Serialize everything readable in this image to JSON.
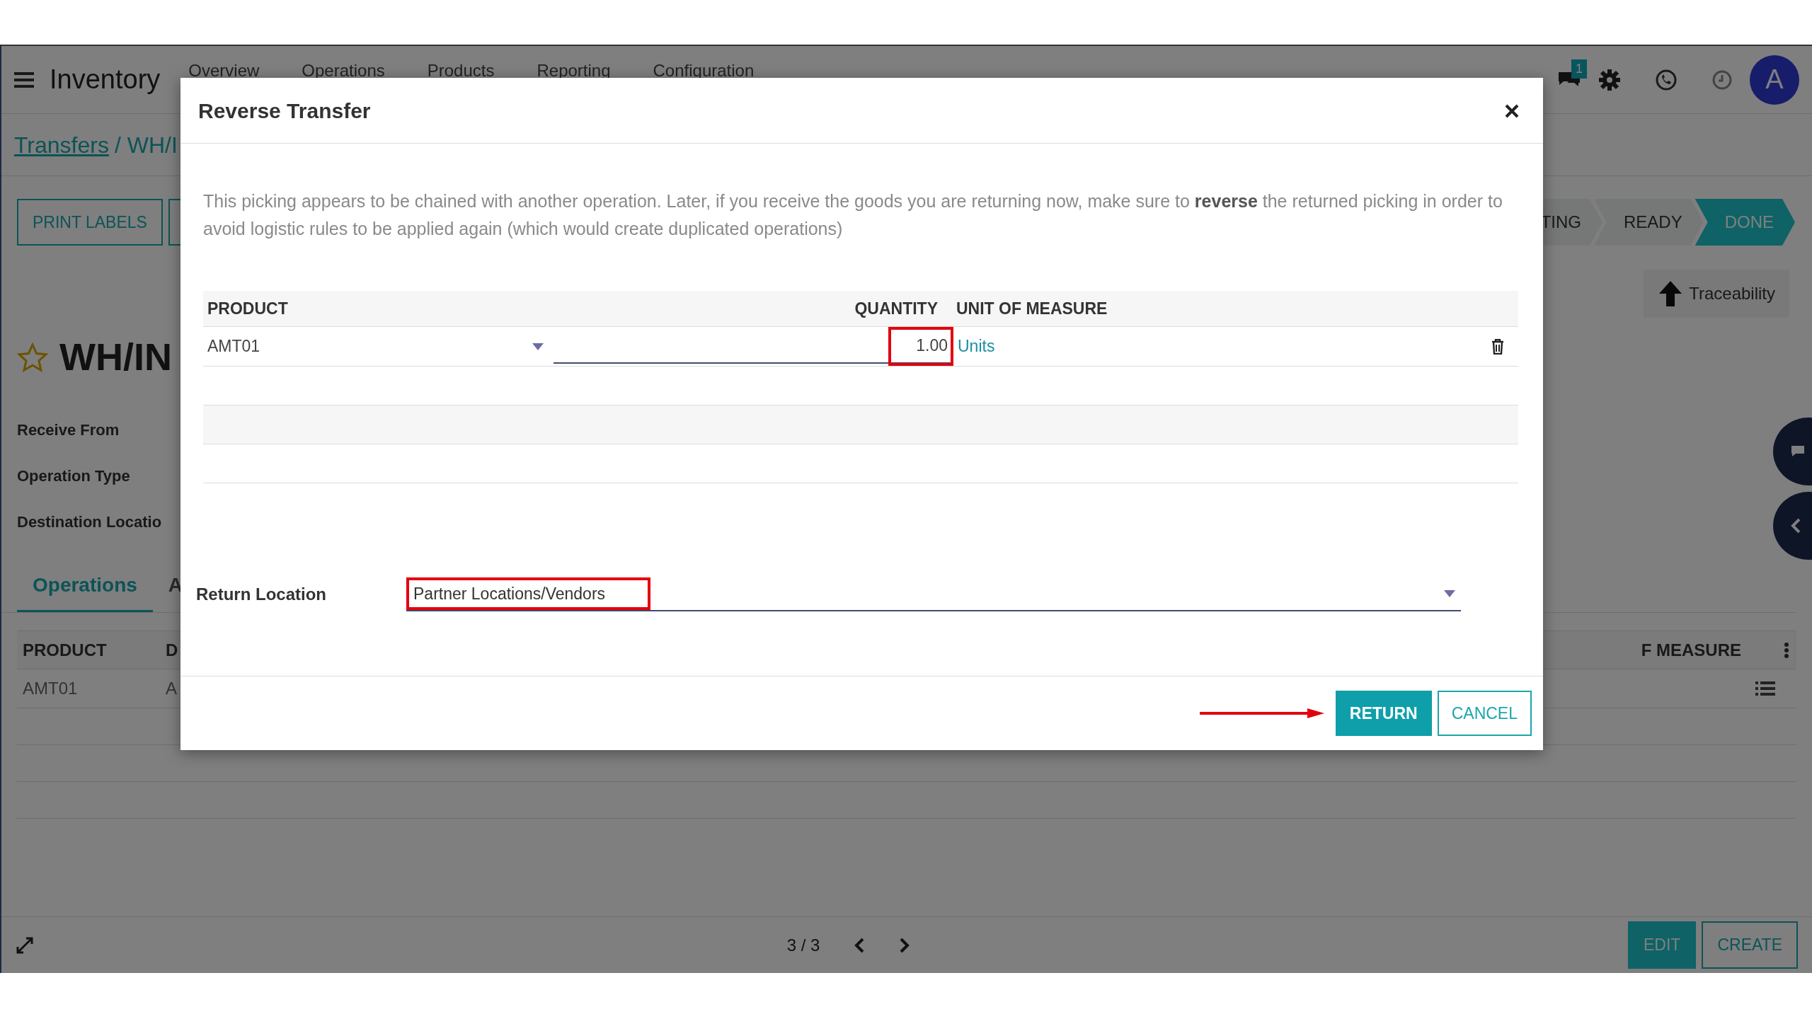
{
  "app_bar": {
    "app_name": "Inventory",
    "menu": [
      "Overview",
      "Operations",
      "Products",
      "Reporting",
      "Configuration"
    ],
    "message_count": "1",
    "avatar_letter": "A"
  },
  "breadcrumb": [
    {
      "label": "Transfers"
    },
    {
      "label": "/ WH/I"
    }
  ],
  "actions": [
    "PRINT LABELS"
  ],
  "status_steps": [
    {
      "label": "TING",
      "selected": false
    },
    {
      "label": "READY",
      "selected": false
    },
    {
      "label": "DONE",
      "selected": true
    }
  ],
  "smart_buttons": [
    "Traceability"
  ],
  "record": {
    "starred": false,
    "title": "WH/IN"
  },
  "fields": [
    "Receive From",
    "Operation Type",
    "Destination Locatio"
  ],
  "tabs": [
    {
      "label": "Operations",
      "selected": true
    },
    {
      "label": "A",
      "selected": false
    }
  ],
  "operations_table": {
    "columns": [
      "PRODUCT",
      "D",
      "F MEASURE"
    ],
    "rows": [
      [
        "AMT01",
        "A"
      ]
    ]
  },
  "pager": "3 / 3",
  "bottom_buttons": [
    {
      "label": "EDIT",
      "kind": "primary"
    },
    {
      "label": "CREATE",
      "kind": "secondary"
    }
  ],
  "dialog": {
    "title": "Reverse Transfer",
    "message": "This picking appears to be chained with another operation. Later, if you receive the goods you are returning now, make sure to **reverse** the returned picking in order to avoid logistic rules to be applied again (which would create duplicated operations)",
    "columns": [
      "PRODUCT",
      "QUANTITY",
      "UNIT OF MEASURE"
    ],
    "lines": [
      {
        "product": "AMT01",
        "quantity": "1.00",
        "unit": "Units"
      }
    ],
    "return_location_label": "Return Location",
    "return_location": "Partner Locations/Vendors",
    "buttons": [
      {
        "label": "RETURN",
        "kind": "primary"
      },
      {
        "label": "CANCEL",
        "kind": "secondary"
      }
    ]
  }
}
